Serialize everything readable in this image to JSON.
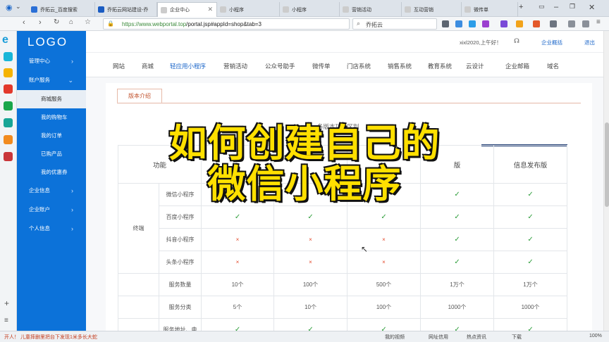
{
  "browser": {
    "tabs": [
      {
        "title": "乔拓云_百度搜索",
        "color": "#2a6fd6"
      },
      {
        "title": "乔拓云网站建设-乔",
        "color": "#1a5cc2"
      },
      {
        "title": "企业中心",
        "color": "#cccccc"
      },
      {
        "title": "小程序",
        "color": "#cccccc"
      },
      {
        "title": "小程序",
        "color": "#cccccc"
      },
      {
        "title": "营销活动",
        "color": "#cccccc"
      },
      {
        "title": "互动营销",
        "color": "#cccccc"
      },
      {
        "title": "微传单",
        "color": "#cccccc"
      }
    ],
    "new_tab": "+",
    "url_domain": "https://www.webportal.top",
    "url_path": "/portal.jsp#appId=shop&tab=3",
    "search_text": "乔拓云"
  },
  "sidebar": {
    "logo": "LOGO",
    "menus": [
      {
        "label": "管理中心"
      },
      {
        "label": "账户服务"
      }
    ],
    "subitems": [
      {
        "label": "商城服务"
      },
      {
        "label": "我的购物车"
      },
      {
        "label": "我的订单"
      },
      {
        "label": "已购产品"
      },
      {
        "label": "我的优惠券"
      }
    ],
    "menus2": [
      {
        "label": "企业信息"
      },
      {
        "label": "企业账户"
      },
      {
        "label": "个人信息"
      }
    ]
  },
  "userbar": {
    "greeting": "xixl2020,上午好！",
    "overview": "企业概括",
    "logout": "退出"
  },
  "nav_tabs": [
    "网站",
    "商城",
    "轻应用小程序",
    "营销活动",
    "公众号助手",
    "微传单",
    "门店系统",
    "销售系统",
    "教育系统",
    "云设计",
    "企业邮箱",
    "域名"
  ],
  "price": {
    "tab": "版本介绍",
    "table_title": "各版本功能区别",
    "col_function": "功能",
    "col_last": "信息发布版",
    "col_5": "版",
    "group_terminal": "终端",
    "rows": [
      {
        "name": "微信小程序",
        "cells": [
          "",
          "",
          "",
          "✓",
          "✓"
        ]
      },
      {
        "name": "百度小程序",
        "cells": [
          "✓",
          "✓",
          "✓",
          "✓",
          "✓"
        ]
      },
      {
        "name": "抖音小程序",
        "cells": [
          "×",
          "×",
          "×",
          "✓",
          "✓"
        ]
      },
      {
        "name": "头条小程序",
        "cells": [
          "×",
          "×",
          "×",
          "✓",
          "✓"
        ]
      },
      {
        "name": "服务数量",
        "cells": [
          "10个",
          "100个",
          "500个",
          "1万个",
          "1万个"
        ]
      },
      {
        "name": "服务分类",
        "cells": [
          "5个",
          "10个",
          "100个",
          "1000个",
          "1000个"
        ]
      },
      {
        "name": "服务地址、电",
        "cells": [
          "✓",
          "✓",
          "✓",
          "✓",
          "✓"
        ]
      }
    ]
  },
  "overlay": {
    "line1": "如何创建自己的",
    "line2": "微信小程序"
  },
  "status": {
    "news": "开人！ 儿童摔删里把台下发现1米多长大蛇",
    "video": "我的视频",
    "netcheck": "网址信用",
    "hot": "热点资讯",
    "download": "下载",
    "zoom": "100%"
  }
}
